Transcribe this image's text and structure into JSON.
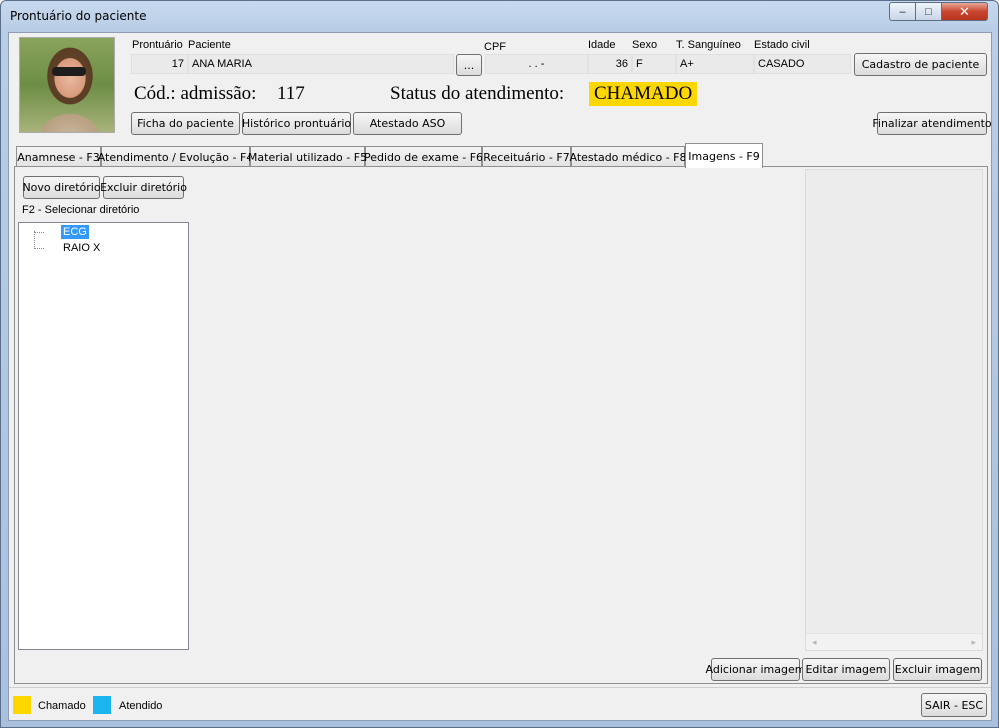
{
  "window": {
    "title": "Prontuário do paciente",
    "minimize_glyph": "–",
    "maximize_glyph": "□",
    "close_glyph": "✕"
  },
  "patient": {
    "photo_icon": "patient-photo",
    "labels": {
      "prontuario": "Prontuário",
      "paciente": "Paciente",
      "cpf": "CPF",
      "idade": "Idade",
      "sexo": "Sexo",
      "tipo_sanguineo": "T. Sanguíneo",
      "estado_civil": "Estado civil"
    },
    "values": {
      "prontuario": "17",
      "paciente": "ANA MARIA",
      "cpf": " .  .  -",
      "idade": "36",
      "sexo": "F",
      "tipo_sanguineo": "A+",
      "estado_civil": "CASADO"
    },
    "browse_label": "...",
    "cadastro_label": "Cadastro de paciente"
  },
  "admission": {
    "code_label": "Cód.: admissão:",
    "code_value": "117",
    "status_label": "Status do atendimento:",
    "status_value": "CHAMADO",
    "status_color": "#ffd700"
  },
  "actions": {
    "ficha": "Ficha do paciente",
    "historico": "Histórico prontuário",
    "atestado_aso": "Atestado ASO",
    "finalizar": "Finalizar atendimento"
  },
  "tabs": [
    {
      "label": "Anamnese - F3",
      "active": false
    },
    {
      "label": "Atendimento / Evolução - F4",
      "active": false
    },
    {
      "label": "Material utilizado - F5",
      "active": false
    },
    {
      "label": "Pedido de exame - F6",
      "active": false
    },
    {
      "label": "Receituário - F7",
      "active": false
    },
    {
      "label": "Atestado médico - F8",
      "active": false
    },
    {
      "label": "Imagens - F9",
      "active": true
    }
  ],
  "imagens": {
    "novo_diretorio": "Novo diretório",
    "excluir_diretorio": "Excluir diretório",
    "select_hint": "F2 - Selecionar diretório",
    "directories": [
      {
        "label": "ECG",
        "selected": true
      },
      {
        "label": "RAIO X",
        "selected": false
      }
    ],
    "scroll_left": "◂",
    "scroll_right": "▸",
    "adicionar": "Adicionar imagem",
    "editar": "Editar imagem",
    "excluir": "Excluir imagem"
  },
  "legend": {
    "items": [
      {
        "label": "Chamado",
        "color": "#ffd700"
      },
      {
        "label": "Atendido",
        "color": "#1cb5f0"
      }
    ],
    "sair": "SAIR - ESC"
  }
}
